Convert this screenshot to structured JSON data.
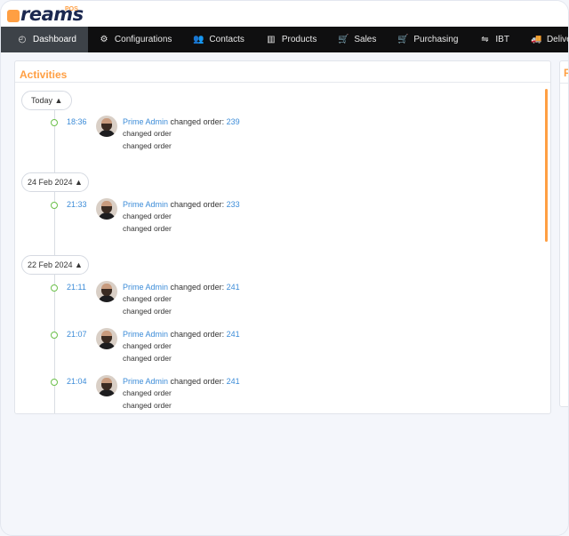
{
  "brand": {
    "logo_text": "reams",
    "logo_initial": "D",
    "pos_label": "POS"
  },
  "nav": {
    "items": [
      {
        "label": "Dashboard",
        "icon": "dashboard-icon",
        "glyph": "◴",
        "active": true
      },
      {
        "label": "Configurations",
        "icon": "gear-icon",
        "glyph": "⚙"
      },
      {
        "label": "Contacts",
        "icon": "users-icon",
        "glyph": "👥"
      },
      {
        "label": "Products",
        "icon": "barcode-icon",
        "glyph": "▥"
      },
      {
        "label": "Sales",
        "icon": "cart-icon",
        "glyph": "🛒"
      },
      {
        "label": "Purchasing",
        "icon": "cart-solid-icon",
        "glyph": "🛒"
      },
      {
        "label": "IBT",
        "icon": "transfer-icon",
        "glyph": "⇋"
      },
      {
        "label": "Deliveries",
        "icon": "truck-icon",
        "glyph": "🚚"
      }
    ]
  },
  "activities": {
    "title": "Activities",
    "groups": [
      {
        "day": "Today ▲",
        "entries": [
          {
            "time": "18:36",
            "user": "Prime Admin",
            "action": " changed order: ",
            "order": "239",
            "lines": [
              "changed order",
              "changed order"
            ]
          }
        ]
      },
      {
        "day": "24 Feb 2024 ▲",
        "entries": [
          {
            "time": "21:33",
            "user": "Prime Admin",
            "action": " changed order: ",
            "order": "233",
            "lines": [
              "changed order",
              "changed order"
            ]
          }
        ]
      },
      {
        "day": "22 Feb 2024 ▲",
        "entries": [
          {
            "time": "21:11",
            "user": "Prime Admin",
            "action": " changed order: ",
            "order": "241",
            "lines": [
              "changed order",
              "changed order"
            ]
          },
          {
            "time": "21:07",
            "user": "Prime Admin",
            "action": " changed order: ",
            "order": "241",
            "lines": [
              "changed order",
              "changed order"
            ]
          },
          {
            "time": "21:04",
            "user": "Prime Admin",
            "action": " changed order: ",
            "order": "241",
            "lines": [
              "changed order",
              "changed order"
            ]
          }
        ]
      }
    ]
  },
  "side_card": {
    "title_initial": "F"
  },
  "colors": {
    "accent": "#ff9f43",
    "link": "#3c8cd8",
    "nav_bg": "#0f0f10",
    "nav_active": "#3d4248",
    "timeline_dot": "#6cc04a"
  }
}
